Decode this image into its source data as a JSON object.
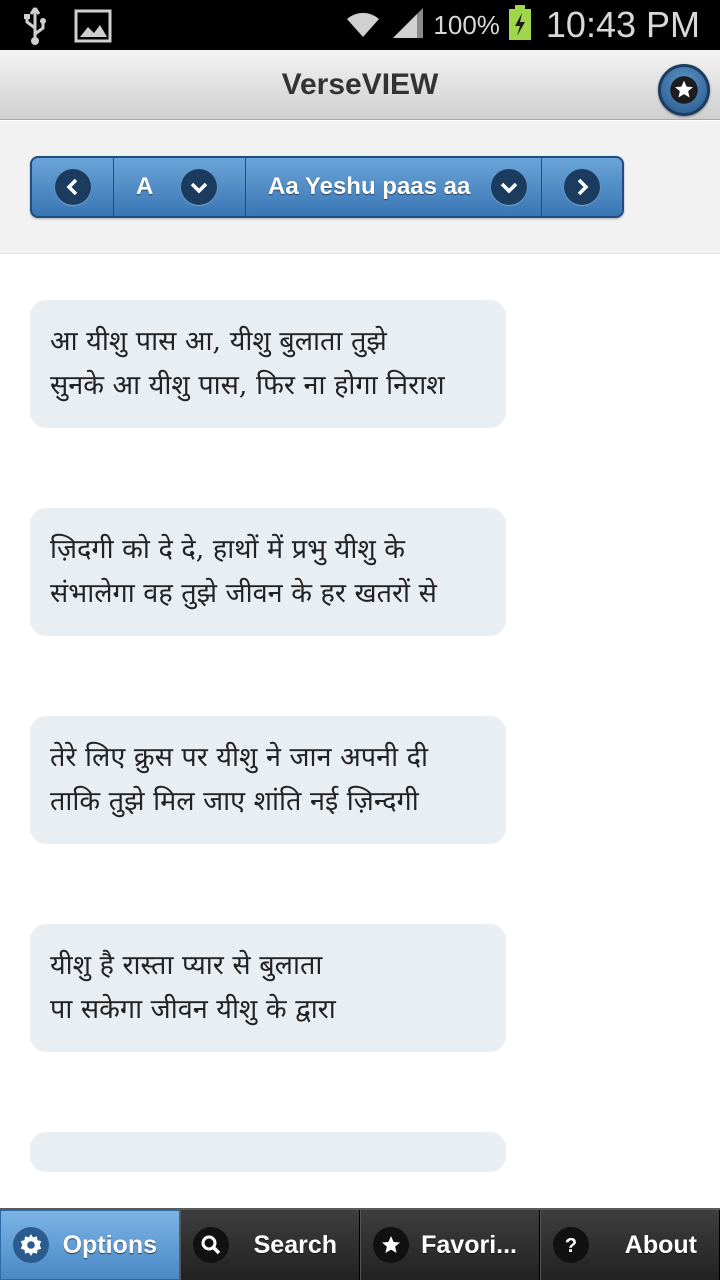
{
  "status_bar": {
    "battery_percent": "100%",
    "time": "10:43 PM",
    "icons": [
      "usb-icon",
      "image-icon",
      "wifi-icon",
      "signal-icon",
      "battery-charging-icon"
    ]
  },
  "header": {
    "title": "VerseVIEW",
    "favorite_icon": "star-icon"
  },
  "nav": {
    "prev_icon": "chevron-left-icon",
    "letter": "A",
    "letter_dropdown_icon": "chevron-down-icon",
    "song": "Aa Yeshu paas aa",
    "song_dropdown_icon": "chevron-down-icon",
    "next_icon": "chevron-right-icon"
  },
  "verses": [
    {
      "lines": [
        "आ यीशु पास आ, यीशु बुलाता तुझे",
        "सुनके आ यीशु पास, फिर ना होगा निराश"
      ]
    },
    {
      "lines": [
        "ज़िदगी को दे दे, हाथों में प्रभु यीशु के",
        "संभालेगा वह तुझे जीवन के हर खतरों से"
      ]
    },
    {
      "lines": [
        "तेरे लिए क्रुस पर यीशु ने जान अपनी दी",
        "ताकि तुझे मिल जाए शांति नई ज़िन्दगी"
      ]
    },
    {
      "lines": [
        "यीशु है रास्ता प्यार से बुलाता",
        "पा सकेगा जीवन यीशु के द्वारा"
      ]
    }
  ],
  "bottom_tabs": [
    {
      "label": "Options",
      "icon": "gear-icon",
      "active": true
    },
    {
      "label": "Search",
      "icon": "search-icon",
      "active": false
    },
    {
      "label": "Favori...",
      "icon": "star-icon",
      "active": false
    },
    {
      "label": "About",
      "icon": "question-icon",
      "active": false
    }
  ],
  "colors": {
    "accent": "#4a88c6",
    "nav_bar": "#3a76b4",
    "verse_bg": "#e9eef3"
  }
}
